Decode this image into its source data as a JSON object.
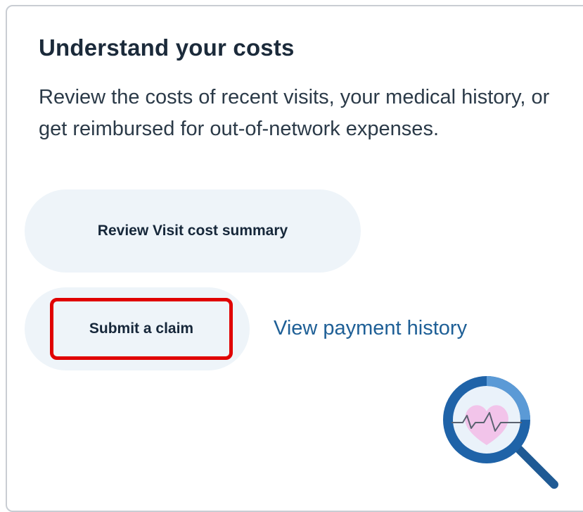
{
  "card": {
    "title": "Understand your costs",
    "description": "Review the costs of recent visits, your medical history, or get reimbursed for out-of-network expenses."
  },
  "actions": {
    "review_label": "Review Visit cost summary",
    "submit_label": "Submit a claim",
    "payment_history_label": "View payment history"
  },
  "colors": {
    "title": "#1b2a3a",
    "pill_background": "#eef4f9",
    "link": "#1e5f96",
    "highlight": "#e00000",
    "magnifier_ring": "#1f63a8",
    "heart": "#f2c4ea"
  },
  "icons": {
    "illustration": "magnifier-heart-icon"
  }
}
